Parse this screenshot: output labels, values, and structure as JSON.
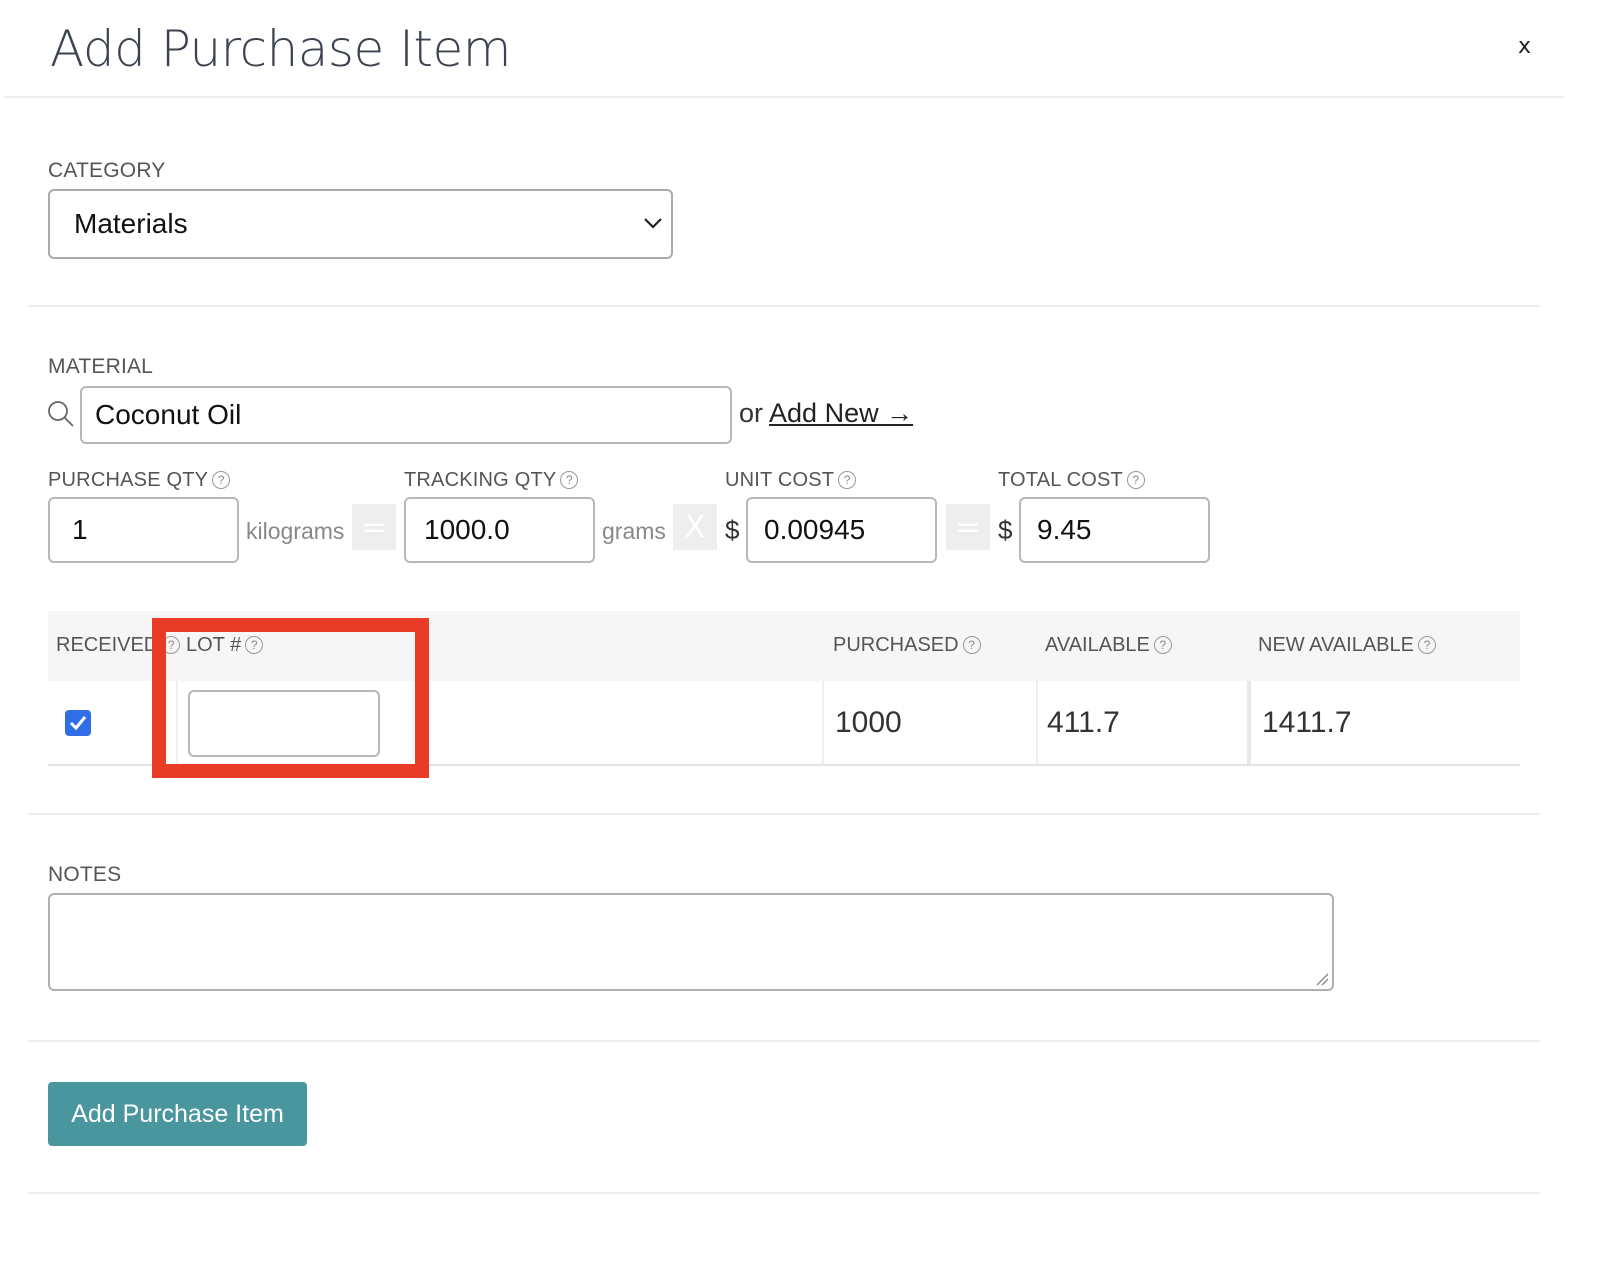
{
  "dialog": {
    "title": "Add Purchase Item",
    "close_label": "x"
  },
  "category": {
    "label": "CATEGORY",
    "selected": "Materials"
  },
  "material": {
    "label": "MATERIAL",
    "value": "Coconut Oil",
    "or_text": "or",
    "add_new_label": "Add New →"
  },
  "quantities": {
    "purchase_qty": {
      "label": "PURCHASE QTY",
      "value": "1",
      "unit": "kilograms"
    },
    "tracking_qty": {
      "label": "TRACKING QTY",
      "value": "1000.0",
      "unit": "grams"
    },
    "unit_cost": {
      "label": "UNIT COST",
      "currency": "$",
      "value": "0.00945"
    },
    "total_cost": {
      "label": "TOTAL COST",
      "currency": "$",
      "value": "9.45"
    },
    "equals_op": "=",
    "times_op": "X"
  },
  "lot_table": {
    "headers": {
      "received": "RECEIVED",
      "lot": "LOT #",
      "purchased": "PURCHASED",
      "available": "AVAILABLE",
      "new_available": "NEW AVAILABLE"
    },
    "row": {
      "received": true,
      "lot": "",
      "purchased": "1000",
      "available": "411.7",
      "new_available": "1411.7"
    }
  },
  "notes": {
    "label": "NOTES",
    "value": ""
  },
  "submit_label": "Add Purchase Item",
  "help_glyph": "?",
  "colors": {
    "primary_button": "#4a969f",
    "checkbox": "#2f6ee6",
    "highlight": "#e83c26"
  }
}
